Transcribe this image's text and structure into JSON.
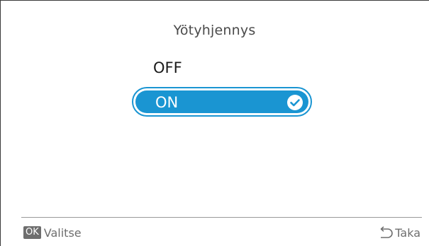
{
  "screen": {
    "title": "Yötyhjennys"
  },
  "options": [
    {
      "label": "OFF",
      "selected": false
    },
    {
      "label": "ON",
      "selected": true
    }
  ],
  "footer": {
    "ok_badge": "OK",
    "select_label": "Valitse",
    "back_label": "Taka"
  },
  "colors": {
    "accent": "#1a95d2",
    "text": "#1a1a1a",
    "muted": "#6e6e6e"
  },
  "icons": {
    "selected": "checkmark-circle-icon",
    "back": "return-arrow-icon"
  }
}
